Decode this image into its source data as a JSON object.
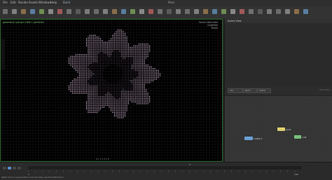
{
  "app": {
    "menu_items": [
      "File",
      "Edit",
      "Render",
      "Assets",
      "Windows",
      "Help"
    ],
    "desktop_label": "Build",
    "right_menu": "Main"
  },
  "viewport": {
    "header_text": "geometry1  persp1  Indie  1 primitive",
    "info_lines": [
      "Scene View  Indie",
      "Quadtree",
      "Points"
    ],
    "footer_text": "0   1   2   3   4   5   6"
  },
  "params": {
    "title": "Scene View"
  },
  "network": {
    "tabs": [
      "obj",
      "geo1",
      "Scene"
    ],
    "context": "Geometry",
    "nodes": [
      {
        "label": "scatter1",
        "color": "#6aa1d8"
      },
      {
        "label": "grid1",
        "color": "#e0d070"
      },
      {
        "label": "out1",
        "color": "#79c27a"
      }
    ]
  },
  "timeline": {
    "frame": "1",
    "start": "1",
    "end": "240"
  },
  "status": {
    "text": "Right-click on a parameter to see the help. Use the Shift key to..."
  },
  "colors": {
    "flower_outer": "#e6c7e6",
    "flower_inner": "#8a6a8a",
    "viewport_border": "#2c6c2c"
  },
  "icons": [
    "menu-icon",
    "shelf-tool-icon",
    "play-icon",
    "stop-icon",
    "node-icon"
  ]
}
